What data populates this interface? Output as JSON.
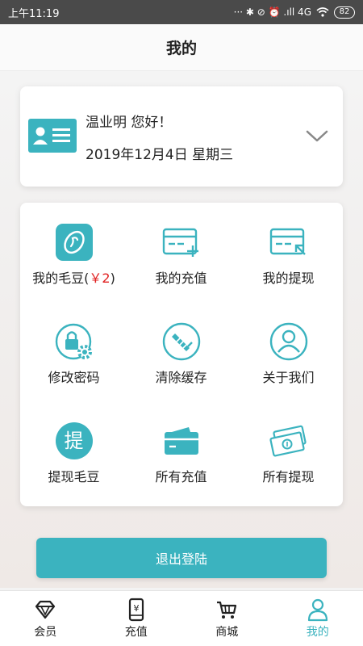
{
  "status_bar": {
    "time": "上午11:19",
    "indicators": "··· ✱ ⊘ ⏰ .ıll 4G",
    "battery": "82"
  },
  "header": {
    "title": "我的"
  },
  "user": {
    "greeting": "温业明 您好！",
    "date": "2019年12月4日 星期三"
  },
  "menu": {
    "beans_label": "我的毛豆(",
    "beans_amount": "￥2",
    "beans_close": ")",
    "recharge": "我的充值",
    "withdraw": "我的提现",
    "change_password": "修改密码",
    "clear_cache": "清除缓存",
    "about_us": "关于我们",
    "withdraw_beans": "提现毛豆",
    "withdraw_beans_icon_char": "提",
    "all_recharge": "所有充值",
    "all_withdraw": "所有提现"
  },
  "logout_label": "退出登陆",
  "tabs": [
    {
      "label": "会员",
      "icon": "diamond-icon"
    },
    {
      "label": "充值",
      "icon": "phone-yen-icon"
    },
    {
      "label": "商城",
      "icon": "cart-icon"
    },
    {
      "label": "我的",
      "icon": "person-icon"
    }
  ],
  "colors": {
    "accent": "#3bb3bf",
    "highlight_red": "#e02020",
    "status_bar_bg": "#4a4a4a"
  }
}
